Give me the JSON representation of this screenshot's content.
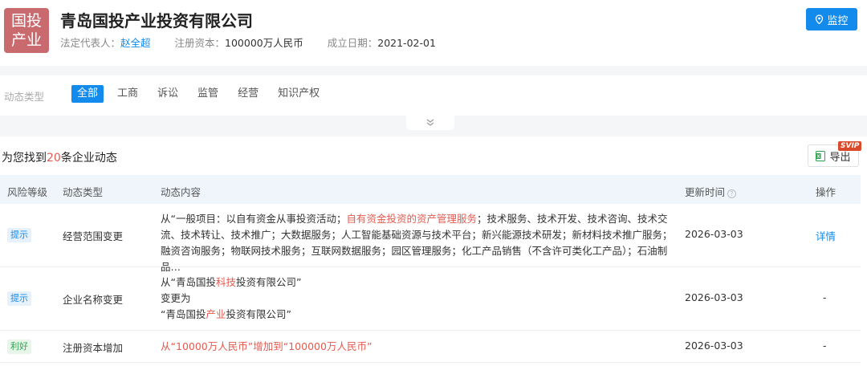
{
  "header": {
    "logo_line1": "国投",
    "logo_line2": "产业",
    "company_name": "青岛国投产业投资有限公司",
    "rep_label": "法定代表人：",
    "rep_value": "赵全超",
    "capital_label": "注册资本：",
    "capital_value": "100000万人民币",
    "date_label": "成立日期：",
    "date_value": "2021-02-01",
    "monitor_label": "监控"
  },
  "filter": {
    "label": "动态类型",
    "tabs": [
      "全部",
      "工商",
      "诉讼",
      "监管",
      "经营",
      "知识产权"
    ]
  },
  "result": {
    "found_prefix": "为您找到",
    "found_count": "20",
    "found_suffix": "条企业动态",
    "export_label": "导出",
    "svip": "SVIP"
  },
  "table": {
    "columns": [
      "风险等级",
      "动态类型",
      "动态内容",
      "更新时间",
      "操作"
    ],
    "rows": [
      {
        "level": "提示",
        "type": "经营范围变更",
        "content_a": "从“一般项目：以自有资金从事投资活动；",
        "content_red": "自有资金投资的资产管理服务",
        "content_b": "；技术服务、技术开发、技术咨询、技术交流、技术转让、技术推广；大数据服务；人工智能基础资源与技术平台；新兴能源技术研发；新材料技术推广服务；融资咨询服务；物联网技术服务；互联网数据服务；园区管理服务；化工产品销售（不含许可类化工产品）；石油制品…",
        "date": "2026-03-03",
        "action": "详情"
      },
      {
        "level": "提示",
        "type": "企业名称变更",
        "line1_a": "从“青岛国投",
        "line1_red": "科技",
        "line1_b": "投资有限公司”",
        "line2": "变更为",
        "line3_a": "“青岛国投",
        "line3_red": "产业",
        "line3_b": "投资有限公司”",
        "date": "2026-03-03",
        "action": "-"
      },
      {
        "level": "利好",
        "type": "注册资本增加",
        "content_a": "从",
        "content_red1": "“10000万人民币”",
        "content_mid": "增加到",
        "content_red2": "“100000万人民币”",
        "date": "2026-03-03",
        "action": "-"
      }
    ]
  },
  "colors": {
    "accent": "#128bed",
    "highlight": "#e55a4f",
    "logo_bg": "#c96a6e"
  }
}
